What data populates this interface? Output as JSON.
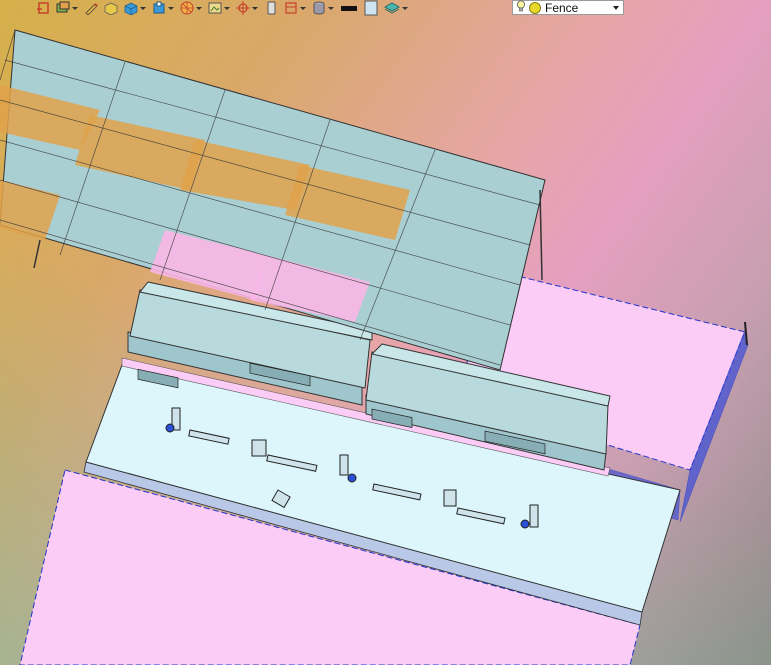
{
  "toolbar": {
    "buttons": [
      {
        "name": "exit-sketch-icon",
        "has_dropdown": false
      },
      {
        "name": "layers-icon",
        "has_dropdown": true
      },
      {
        "name": "pencil-icon",
        "has_dropdown": false
      },
      {
        "name": "box-icon",
        "has_dropdown": false
      },
      {
        "name": "cube-icon",
        "has_dropdown": true
      },
      {
        "name": "component-icon",
        "has_dropdown": true
      },
      {
        "name": "section-wheel-icon",
        "has_dropdown": true
      },
      {
        "name": "image-view-icon",
        "has_dropdown": true
      },
      {
        "name": "move-target-icon",
        "has_dropdown": true
      },
      {
        "name": "phone-icon",
        "has_dropdown": false
      },
      {
        "name": "frame-icon",
        "has_dropdown": true
      },
      {
        "name": "cylinder-icon",
        "has_dropdown": true
      },
      {
        "name": "line-color-icon",
        "has_dropdown": false
      },
      {
        "name": "page-icon",
        "has_dropdown": false
      },
      {
        "name": "material-icon",
        "has_dropdown": true
      }
    ],
    "view_select": {
      "value": "Fence",
      "icon": "lightbulb-icon",
      "dot_color": "#e6d82a"
    }
  },
  "colors": {
    "platform": "#dcf6fb",
    "ground_pink": "#fbcdf6",
    "canopy": "#a9cfd3",
    "fence_blue": "#2233cc"
  }
}
